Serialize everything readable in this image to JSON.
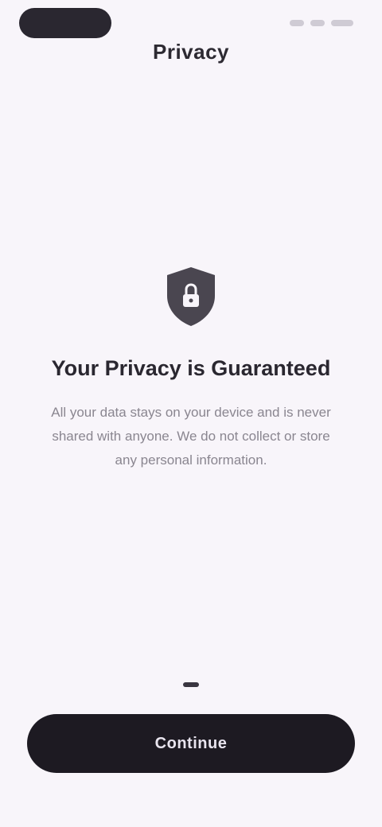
{
  "app": {
    "title": "Privacy"
  },
  "onboarding": {
    "icon": "shield-lock-icon",
    "headline": "Your Privacy is Guaranteed",
    "body": "All your data stays on your device and is never shared with anyone. We do not collect or store any personal information.",
    "page_indicator_count": 1
  },
  "actions": {
    "continue_label": "Continue"
  },
  "colors": {
    "background": "#f8f5fa",
    "primary": "#1d1a22",
    "icon": "#4a4650",
    "body_text": "#8a8690"
  }
}
